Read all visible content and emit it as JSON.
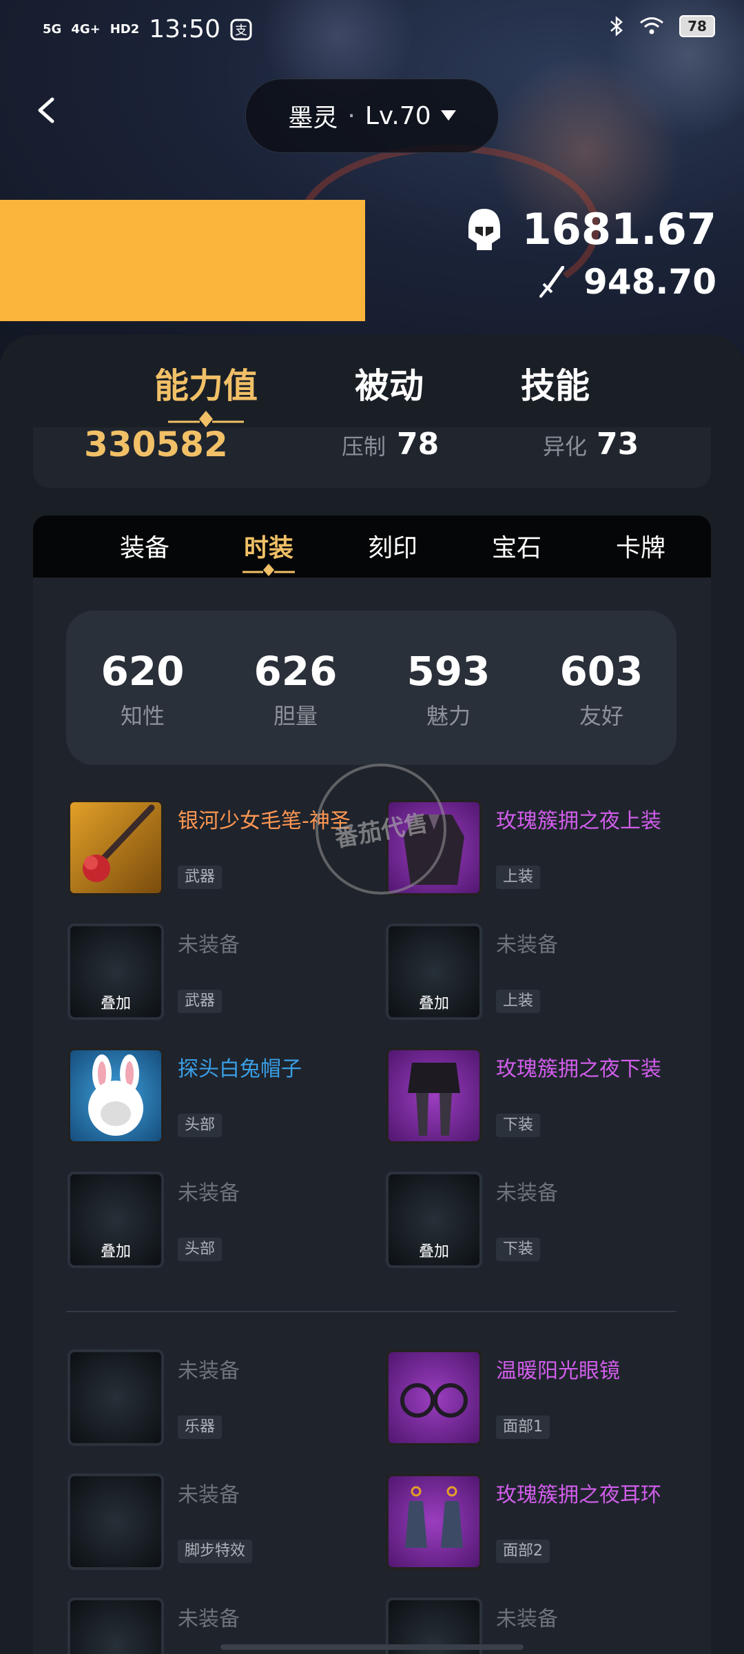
{
  "status_bar": {
    "network1": "5G",
    "network2": "4G+",
    "hd": "HD2",
    "time": "13:50",
    "battery": "78"
  },
  "header": {
    "character": "墨灵",
    "separator": "·",
    "level": "Lv.70"
  },
  "stats": {
    "defense": "1681.67",
    "attack": "948.70"
  },
  "main_tabs": [
    {
      "label": "能力值"
    },
    {
      "label": "被动"
    },
    {
      "label": "技能"
    }
  ],
  "summary": {
    "value": "330582",
    "label_a": "压制",
    "value_a": "78",
    "label_b": "异化",
    "value_b": "73"
  },
  "sub_tabs": [
    {
      "label": "装备"
    },
    {
      "label": "时装"
    },
    {
      "label": "刻印"
    },
    {
      "label": "宝石"
    },
    {
      "label": "卡牌"
    }
  ],
  "attributes": [
    {
      "value": "620",
      "label": "知性"
    },
    {
      "value": "626",
      "label": "胆量"
    },
    {
      "value": "593",
      "label": "魅力"
    },
    {
      "value": "603",
      "label": "友好"
    }
  ],
  "slots": [
    {
      "name": "银河少女毛笔-神圣",
      "tag": "武器",
      "overlay": ""
    },
    {
      "name": "玫瑰簇拥之夜上装",
      "tag": "上装",
      "overlay": ""
    },
    {
      "name": "未装备",
      "tag": "武器",
      "overlay": "叠加"
    },
    {
      "name": "未装备",
      "tag": "上装",
      "overlay": "叠加"
    },
    {
      "name": "探头白兔帽子",
      "tag": "头部",
      "overlay": ""
    },
    {
      "name": "玫瑰簇拥之夜下装",
      "tag": "下装",
      "overlay": ""
    },
    {
      "name": "未装备",
      "tag": "头部",
      "overlay": "叠加"
    },
    {
      "name": "未装备",
      "tag": "下装",
      "overlay": "叠加"
    },
    {
      "name": "未装备",
      "tag": "乐器",
      "overlay": ""
    },
    {
      "name": "温暖阳光眼镜",
      "tag": "面部1",
      "overlay": ""
    },
    {
      "name": "未装备",
      "tag": "脚步特效",
      "overlay": ""
    },
    {
      "name": "玫瑰簇拥之夜耳环",
      "tag": "面部2",
      "overlay": ""
    },
    {
      "name": "未装备",
      "tag": "",
      "overlay": ""
    },
    {
      "name": "未装备",
      "tag": "",
      "overlay": ""
    }
  ],
  "watermark": "番茄代售",
  "colors": {
    "accent_gold": "#f1c067",
    "rarity_purple": "#d05dea",
    "rarity_orange": "#ff9752",
    "rarity_blue": "#3aa0e8"
  }
}
